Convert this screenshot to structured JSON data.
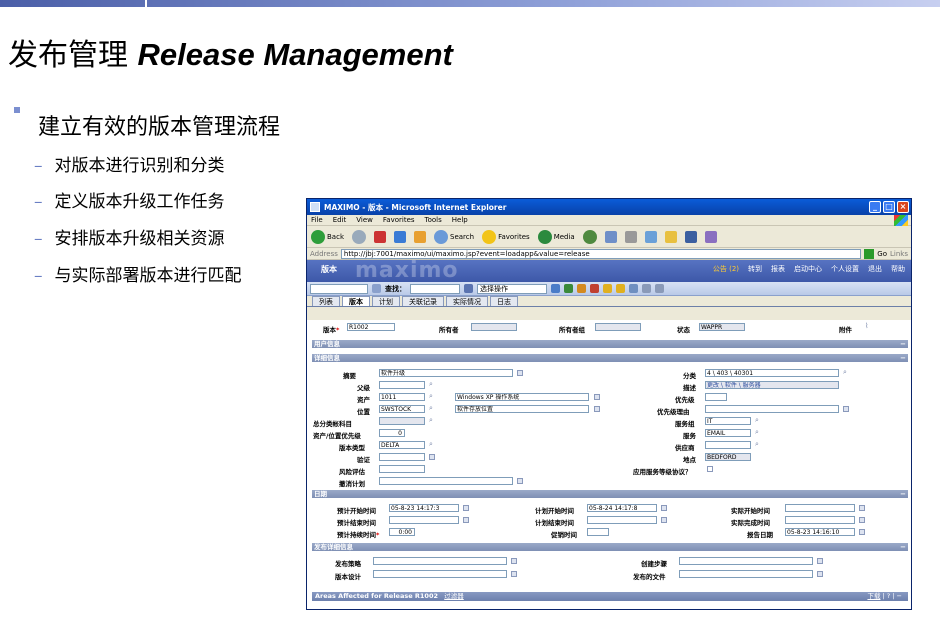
{
  "slide": {
    "title_cn": "发布管理",
    "title_en": "Release Management",
    "bullet": "建立有效的版本管理流程",
    "subbullets": [
      "对版本进行识别和分类",
      "定义版本升级工作任务",
      "安排版本升级相关资源",
      "与实际部署版本进行匹配"
    ]
  },
  "browser": {
    "title": "MAXIMO - 版本 - Microsoft Internet Explorer",
    "menu": [
      "File",
      "Edit",
      "View",
      "Favorites",
      "Tools",
      "Help"
    ],
    "toolbar": {
      "back": "Back",
      "search": "Search",
      "favorites": "Favorites",
      "media": "Media"
    },
    "address_label": "Address",
    "address": "http://jbj:7001/maximo/ui/maximo.jsp?event=loadapp&value=release",
    "go": "Go",
    "links": "Links"
  },
  "app": {
    "logo": "maximo",
    "module": "版本",
    "nav": [
      "公告 (2)",
      "转到",
      "报表",
      "启动中心",
      "个人设置",
      "退出",
      "帮助"
    ],
    "query_label": "查找：",
    "action_label": "选择操作",
    "tabs": [
      "列表",
      "版本",
      "计划",
      "关联记录",
      "实际情况",
      "日志"
    ]
  },
  "form": {
    "header": {
      "release_label": "版本",
      "release": "R1002",
      "owner_label": "所有者",
      "owner_group_label": "所有者组",
      "status_label": "状态",
      "status": "WAPPR",
      "attach_label": "附件"
    },
    "sections": {
      "user": "用户信息",
      "detail": "详细信息",
      "dates": "日期",
      "publish": "发布详细信息"
    },
    "detail": {
      "summary_label": "摘要",
      "summary": "软件升级",
      "parent_label": "父级",
      "asset_label": "资产",
      "asset": "1011",
      "asset_desc": "Windows XP 操作系统",
      "location_label": "位置",
      "location": "SWSTOCK",
      "location_desc": "软件存放位置",
      "gl_label": "总分类帐科目",
      "priority_asset_label": "资产/位置优先级",
      "priority_asset": "0",
      "type_label": "版本类型",
      "type": "DELTA",
      "verify_label": "验证",
      "risk_label": "风险评估",
      "backout_label": "撤消计划",
      "class_label": "分类",
      "class": "4 \\ 403 \\ 40301",
      "desc_label": "描述",
      "desc": "更改 \\ 软件 \\ 服务器",
      "priority_label": "优先级",
      "priority_reason_label": "优先级理由",
      "service_group_label": "服务组",
      "service_group": "IT",
      "service_label": "服务",
      "service": "EMAIL",
      "vendor_label": "供应商",
      "site_label": "地点",
      "site": "BEDFORD",
      "sla_label": "应用服务等级协议？"
    },
    "dates": {
      "tgt_start_label": "预计开始时间",
      "tgt_start": "05-8-23 14:17:3",
      "tgt_finish_label": "预计结束时间",
      "tgt_duration_label": "预计持续时间",
      "tgt_duration": "0:00",
      "sched_start_label": "计划开始时间",
      "sched_start": "05-8-24 14:17:8",
      "sched_finish_label": "计划结束时间",
      "lead_label": "促销时间",
      "act_start_label": "实际开始时间",
      "act_finish_label": "实际完成时间",
      "report_date_label": "报告日期",
      "report_date": "05-8-23 14:16:10"
    },
    "publish": {
      "strategy_label": "发布策略",
      "design_label": "版本设计",
      "steps_label": "创建步骤",
      "docs_label": "发布的文件"
    },
    "bottom": {
      "title": "Areas Affected for Release R1002",
      "filter": "过滤器",
      "download": "下载"
    }
  }
}
